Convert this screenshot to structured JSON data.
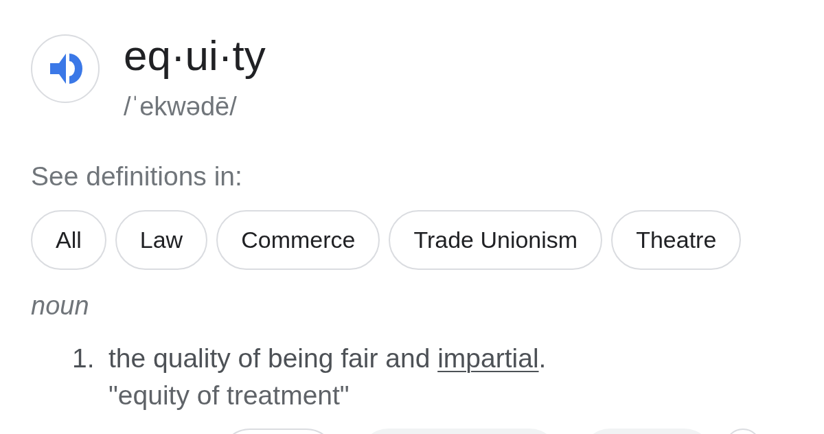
{
  "entry": {
    "headword": "eq·ui·ty",
    "pronunciation": "/ˈekwədē/"
  },
  "see_definitions": {
    "label": "See definitions in:",
    "chips": [
      "All",
      "Law",
      "Commerce",
      "Trade Unionism",
      "Theatre"
    ]
  },
  "part_of_speech": "noun",
  "definitions": [
    {
      "number": "1.",
      "text_before": "the quality of being fair and ",
      "link": "impartial",
      "text_after": ".",
      "example": "\"equity of treatment\""
    }
  ],
  "cut_off_chips": [
    {
      "kind": "outlined"
    },
    {
      "kind": "filled"
    },
    {
      "kind": "filled"
    },
    {
      "kind": "outlined"
    }
  ]
}
